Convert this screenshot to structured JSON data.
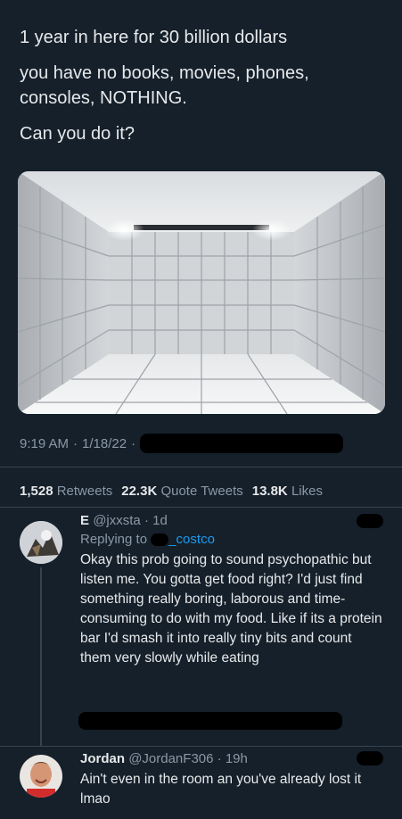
{
  "tweet": {
    "lines": [
      "1 year in here for 30 billion dollars",
      "you have no books, movies, phones, consoles, NOTHING.",
      "Can you do it?"
    ],
    "time": "9:19 AM",
    "sep": "·",
    "date": "1/18/22",
    "sep2": "·"
  },
  "stats": {
    "retweets_count": "1,528",
    "retweets_label": "Retweets",
    "quotes_count": "22.3K",
    "quotes_label": "Quote Tweets",
    "likes_count": "13.8K",
    "likes_label": "Likes"
  },
  "replies": [
    {
      "name": "E",
      "handle": "@jxxsta",
      "sep": "·",
      "time": "1d",
      "replying_to": "Replying to",
      "replying_handle": "_costco",
      "text": "Okay this prob going to sound psychopathic but listen me. You gotta get food right? I'd just find something really boring, laborous and time-consuming to do with my food. Like if its a protein bar I'd smash it into really tiny bits and count them very slowly while eating"
    },
    {
      "name": "Jordan",
      "handle": "@JordanF306",
      "sep": "·",
      "time": "19h",
      "text": "Ain't even in the room an you've already lost it lmao"
    }
  ]
}
